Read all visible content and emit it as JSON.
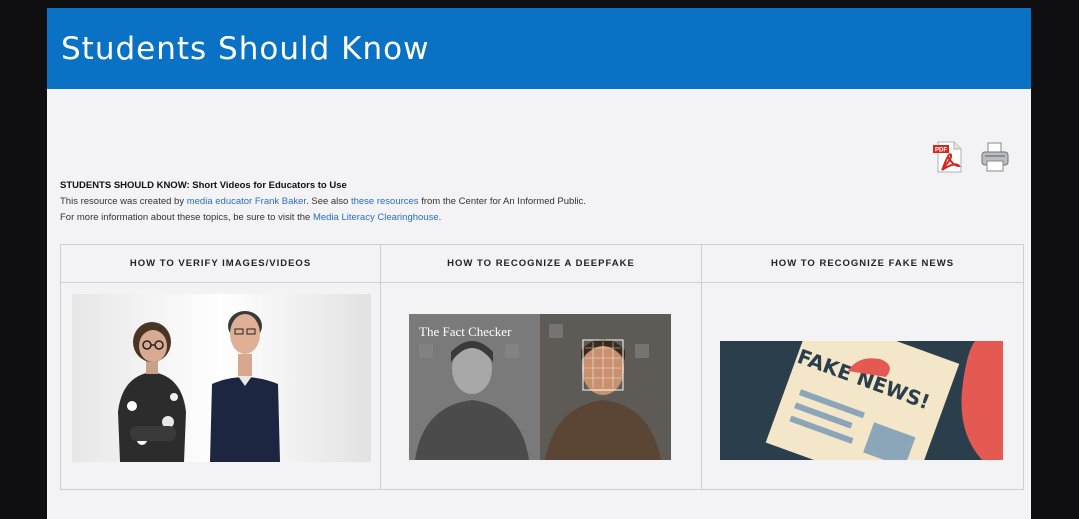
{
  "header": {
    "title": "Students Should Know"
  },
  "toolbar": {
    "pdf_icon": "pdf-file-icon",
    "print_icon": "printer-icon"
  },
  "intro": {
    "heading": "STUDENTS SHOULD KNOW:  Short Videos for Educators to Use",
    "line1_before": "This resource was created by ",
    "line1_link1": "media educator Frank Baker",
    "line1_middle": ".  See also ",
    "line1_link2": "these resources",
    "line1_after": " from the Center for An Informed Public.",
    "line2_before": "For more information about these topics, be sure to visit the ",
    "line2_link": "Media Literacy Clearinghouse",
    "line2_after": "."
  },
  "videos": [
    {
      "title": "HOW TO VERIFY IMAGES/VIDEOS"
    },
    {
      "title": "HOW TO RECOGNIZE A DEEPFAKE",
      "thumb_caption": "The Fact Checker"
    },
    {
      "title": "HOW TO RECOGNIZE FAKE NEWS",
      "thumb_caption": "FAKE NEWS!"
    }
  ],
  "colors": {
    "header_bg": "#0a72c4",
    "link": "#2a6ebd",
    "page_bg": "#f3f3f5"
  }
}
